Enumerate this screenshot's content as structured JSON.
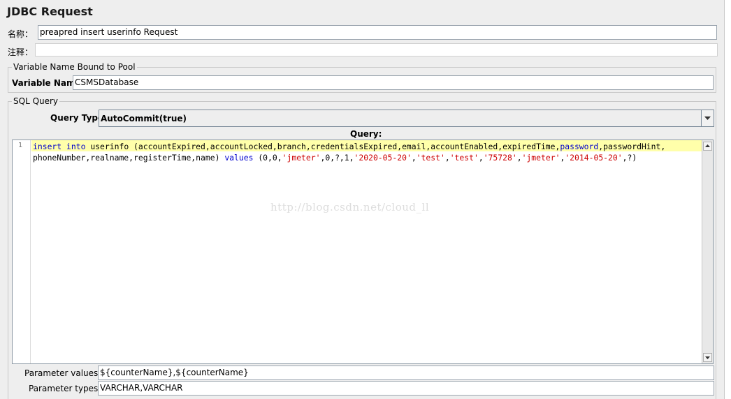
{
  "panel": {
    "title": "JDBC Request"
  },
  "name_row": {
    "label": "名称：",
    "value": "preapred insert userinfo Request"
  },
  "comment_row": {
    "label": "注释：",
    "value": ""
  },
  "pool_group": {
    "legend": "Variable Name Bound to Pool",
    "label": "Variable Name:",
    "value": "CSMSDatabase"
  },
  "sql_group": {
    "legend": "SQL Query",
    "query_type_label": "Query Type:",
    "query_type_value": "AutoCommit(true)",
    "query_label": "Query:",
    "line_number": "1",
    "code": {
      "kw_insert": "insert",
      "kw_into": "into",
      "l1_text": "userinfo (accountExpired,accountLocked,branch,credentialsExpired,email,accountEnabled,expiredTime,",
      "kw_password": "password",
      "l1_tail": ",passwordHint,",
      "l2_head": "phoneNumber,realname,registerTime,name) ",
      "kw_values": "values",
      "l2_open": " (0,0,",
      "s1": "'jmeter'",
      "l2_mid1": ",0,?,1,",
      "s2": "'2020-05-20'",
      "c1": ",",
      "s3": "'test'",
      "c2": ",",
      "s4": "'test'",
      "c3": ",",
      "s5": "'75728'",
      "c4": ",",
      "s6": "'jmeter'",
      "c5": ",",
      "s7": "'2014-05-20'",
      "l2_end": ",?)"
    },
    "watermark": "http://blog.csdn.net/cloud_ll",
    "param_values_label": "Parameter values:",
    "param_values": "${counterName},${counterName}",
    "param_types_label": "Parameter types:",
    "param_types": "VARCHAR,VARCHAR"
  }
}
